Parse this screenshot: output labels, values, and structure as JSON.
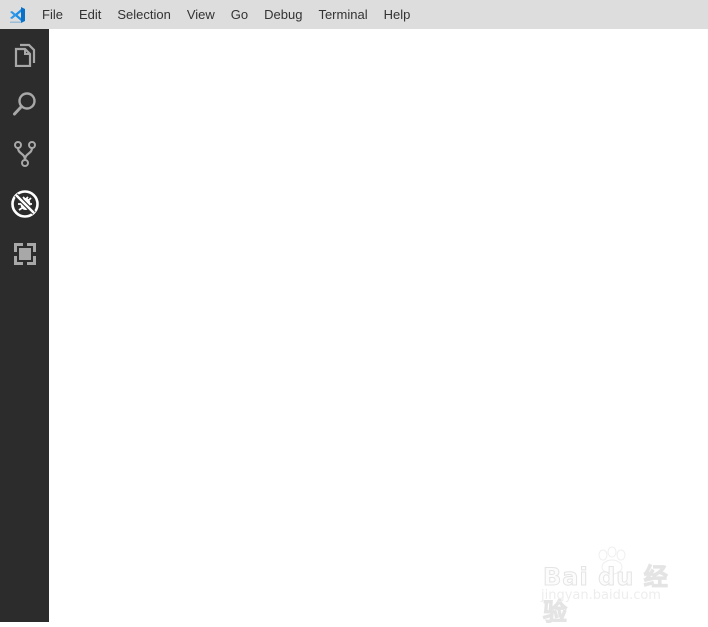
{
  "app": {
    "logo": "vscode-logo"
  },
  "menu": {
    "items": [
      "File",
      "Edit",
      "Selection",
      "View",
      "Go",
      "Debug",
      "Terminal",
      "Help"
    ]
  },
  "activity_bar": {
    "items": [
      {
        "icon": "explorer-icon",
        "label": "Explorer",
        "active": false
      },
      {
        "icon": "search-icon",
        "label": "Search",
        "active": false
      },
      {
        "icon": "source-control-icon",
        "label": "Source Control",
        "active": false
      },
      {
        "icon": "debug-icon",
        "label": "Debug",
        "active": true
      },
      {
        "icon": "extensions-icon",
        "label": "Extensions",
        "active": false
      }
    ]
  },
  "watermark": {
    "brand": "Bai du 经验",
    "url": "jingyan.baidu.com"
  },
  "colors": {
    "accent": "#0078d4",
    "activity_bg": "#2c2c2c",
    "titlebar_bg": "#dddddd",
    "icon_inactive": "#a8a8a8",
    "icon_active": "#ffffff"
  }
}
